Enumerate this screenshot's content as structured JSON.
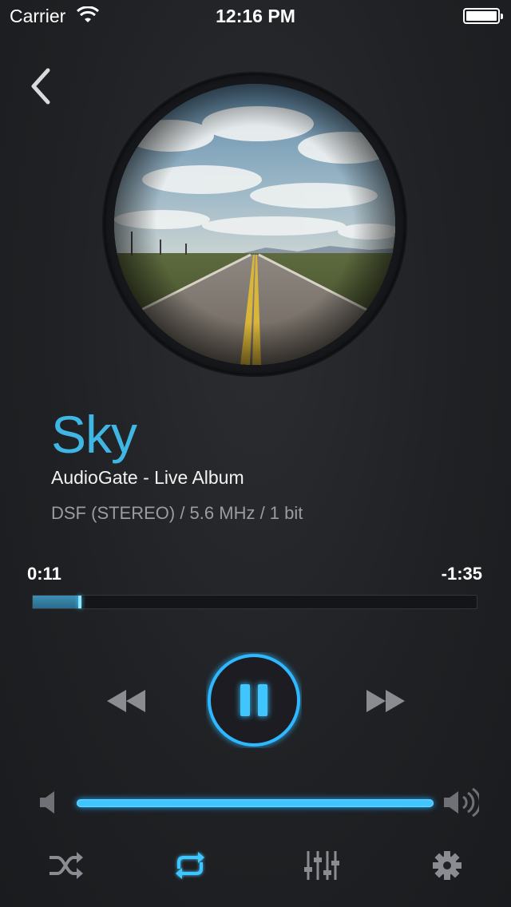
{
  "status_bar": {
    "carrier": "Carrier",
    "time": "12:16 PM",
    "icons": [
      "wifi-icon",
      "battery-icon"
    ]
  },
  "nav": {
    "back_icon": "chevron-left-icon"
  },
  "artwork": {
    "kind": "album-art"
  },
  "track": {
    "title": "Sky",
    "subtitle": "AudioGate - Live Album",
    "format": "DSF (STEREO) / 5.6 MHz / 1 bit"
  },
  "progress": {
    "elapsed": "0:11",
    "remaining": "-1:35",
    "fraction": 0.11
  },
  "controls": {
    "rewind_icon": "rewind-icon",
    "pause_icon": "pause-icon",
    "forward_icon": "fast-forward-icon"
  },
  "volume": {
    "level": 1.0
  },
  "toolbar": {
    "items": [
      "shuffle-icon",
      "repeat-icon",
      "equalizer-icon",
      "gear-icon"
    ],
    "active": "repeat-icon"
  },
  "colors": {
    "accent": "#3fb6e3",
    "glow": "#20a8ff",
    "background": "#1f2124",
    "muted_text": "#9a9ca1",
    "icon_gray": "#8a8c91"
  }
}
